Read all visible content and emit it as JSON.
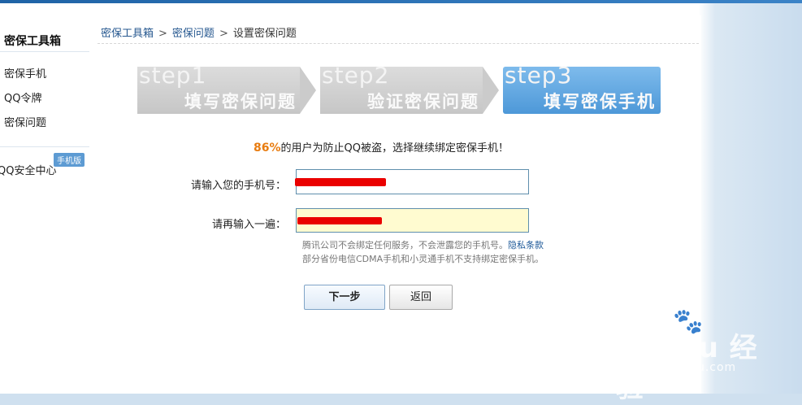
{
  "sidebar": {
    "title": "密保工具箱",
    "items": [
      {
        "label": "密保手机"
      },
      {
        "label": "QQ令牌"
      },
      {
        "label": "密保问题"
      }
    ],
    "security_center": "QQ安全中心",
    "badge": "手机版"
  },
  "breadcrumb": {
    "root": "密保工具箱",
    "sep": ">",
    "middle": "密保问题",
    "current": "设置密保问题"
  },
  "steps": [
    {
      "num": "step1",
      "name": "填写密保问题",
      "state": "done"
    },
    {
      "num": "step2",
      "name": "验证密保问题",
      "state": "done"
    },
    {
      "num": "step3",
      "name": "填写密保手机",
      "state": "active"
    }
  ],
  "tip": {
    "percent": "86%",
    "text": "的用户为防止QQ被盗，选择继续绑定密保手机！"
  },
  "form": {
    "phone_label": "请输入您的手机号：",
    "confirm_label": "请再输入一遍：",
    "note_line1": "腾讯公司不会绑定任何服务，不会泄露您的手机号。",
    "privacy_link": "隐私条款",
    "note_line2": "部分省份电信CDMA手机和小灵通手机不支持绑定密保手机。"
  },
  "buttons": {
    "next": "下一步",
    "back": "返回"
  },
  "watermark": {
    "brand": "Bai du 经验",
    "site": "jingyan.baidu.com"
  },
  "colors": {
    "accent": "#25578f",
    "percent": "#e87c10",
    "step_active": "#5aa2dc",
    "step_done": "#cdcdcd",
    "redaction": "#ea0000",
    "confirm_bg": "#fffbd0"
  }
}
